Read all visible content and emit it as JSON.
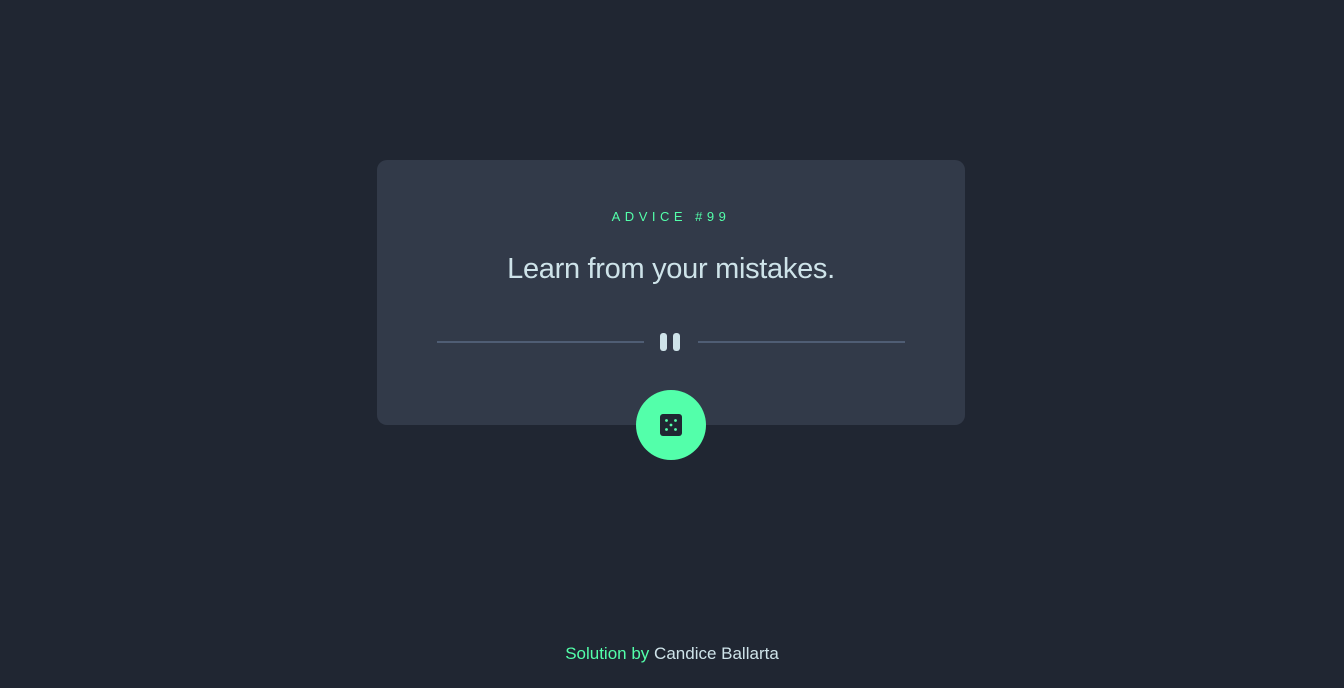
{
  "card": {
    "advice_label": "ADVICE #99",
    "advice_text": "Learn from your mistakes."
  },
  "icons": {
    "divider": "pause-icon",
    "generate": "dice-icon"
  },
  "footer": {
    "prefix": "Solution by",
    "author": "Candice Ballarta"
  },
  "colors": {
    "background": "#202632",
    "card": "#323a49",
    "accent": "#53ffaa",
    "text": "#cee3e9",
    "divider": "#4f5d74"
  }
}
